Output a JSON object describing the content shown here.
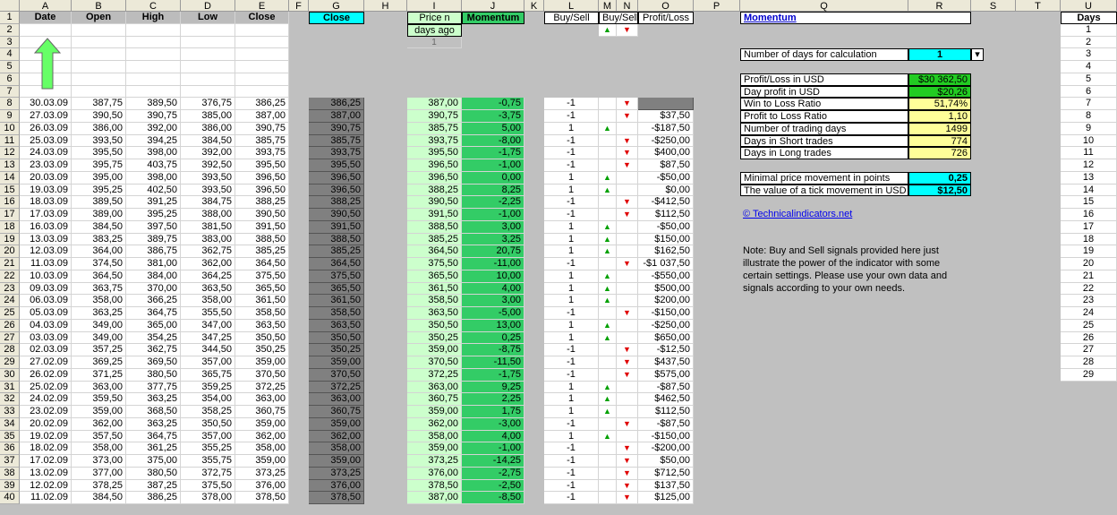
{
  "columns": [
    "A",
    "B",
    "C",
    "D",
    "E",
    "F",
    "G",
    "H",
    "I",
    "J",
    "K",
    "L",
    "M",
    "N",
    "O",
    "P",
    "Q",
    "R",
    "S",
    "T",
    "U"
  ],
  "headers": {
    "date": "Date",
    "open": "Open",
    "high": "High",
    "low": "Low",
    "close": "Close",
    "close_g": "Close",
    "price_n_line1": "Price n",
    "price_n_line2": "days ago",
    "price_n_line3": "1",
    "momentum": "Momentum",
    "buy_sell_l": "Buy/Sell",
    "buy_sell_mn": "Buy/Sell",
    "profit_loss": "Profit/Loss",
    "days": "Days"
  },
  "arrows": {
    "up": "▲",
    "down": "▼"
  },
  "rows": [
    [
      "30.03.09",
      "387,75",
      "389,50",
      "376,75",
      "386,25",
      "386,25",
      "387,00",
      "-0,75",
      "-1",
      "dn",
      ""
    ],
    [
      "27.03.09",
      "390,50",
      "390,75",
      "385,00",
      "387,00",
      "387,00",
      "390,75",
      "-3,75",
      "-1",
      "dn",
      "$37,50"
    ],
    [
      "26.03.09",
      "386,00",
      "392,00",
      "386,00",
      "390,75",
      "390,75",
      "385,75",
      "5,00",
      "1",
      "up",
      "-$187,50"
    ],
    [
      "25.03.09",
      "393,50",
      "394,25",
      "384,50",
      "385,75",
      "385,75",
      "393,75",
      "-8,00",
      "-1",
      "dn",
      "-$250,00"
    ],
    [
      "24.03.09",
      "395,50",
      "398,00",
      "392,00",
      "393,75",
      "393,75",
      "395,50",
      "-1,75",
      "-1",
      "dn",
      "$400,00"
    ],
    [
      "23.03.09",
      "395,75",
      "403,75",
      "392,50",
      "395,50",
      "395,50",
      "396,50",
      "-1,00",
      "-1",
      "dn",
      "$87,50"
    ],
    [
      "20.03.09",
      "395,00",
      "398,00",
      "393,50",
      "396,50",
      "396,50",
      "396,50",
      "0,00",
      "1",
      "up",
      "-$50,00"
    ],
    [
      "19.03.09",
      "395,25",
      "402,50",
      "393,50",
      "396,50",
      "396,50",
      "388,25",
      "8,25",
      "1",
      "up",
      "$0,00"
    ],
    [
      "18.03.09",
      "389,50",
      "391,25",
      "384,75",
      "388,25",
      "388,25",
      "390,50",
      "-2,25",
      "-1",
      "dn",
      "-$412,50"
    ],
    [
      "17.03.09",
      "389,00",
      "395,25",
      "388,00",
      "390,50",
      "390,50",
      "391,50",
      "-1,00",
      "-1",
      "dn",
      "$112,50"
    ],
    [
      "16.03.09",
      "384,50",
      "397,50",
      "381,50",
      "391,50",
      "391,50",
      "388,50",
      "3,00",
      "1",
      "up",
      "-$50,00"
    ],
    [
      "13.03.09",
      "383,25",
      "389,75",
      "383,00",
      "388,50",
      "388,50",
      "385,25",
      "3,25",
      "1",
      "up",
      "$150,00"
    ],
    [
      "12.03.09",
      "364,00",
      "386,75",
      "362,75",
      "385,25",
      "385,25",
      "364,50",
      "20,75",
      "1",
      "up",
      "$162,50"
    ],
    [
      "11.03.09",
      "374,50",
      "381,00",
      "362,00",
      "364,50",
      "364,50",
      "375,50",
      "-11,00",
      "-1",
      "dn",
      "-$1 037,50"
    ],
    [
      "10.03.09",
      "364,50",
      "384,00",
      "364,25",
      "375,50",
      "375,50",
      "365,50",
      "10,00",
      "1",
      "up",
      "-$550,00"
    ],
    [
      "09.03.09",
      "363,75",
      "370,00",
      "363,50",
      "365,50",
      "365,50",
      "361,50",
      "4,00",
      "1",
      "up",
      "$500,00"
    ],
    [
      "06.03.09",
      "358,00",
      "366,25",
      "358,00",
      "361,50",
      "361,50",
      "358,50",
      "3,00",
      "1",
      "up",
      "$200,00"
    ],
    [
      "05.03.09",
      "363,25",
      "364,75",
      "355,50",
      "358,50",
      "358,50",
      "363,50",
      "-5,00",
      "-1",
      "dn",
      "-$150,00"
    ],
    [
      "04.03.09",
      "349,00",
      "365,00",
      "347,00",
      "363,50",
      "363,50",
      "350,50",
      "13,00",
      "1",
      "up",
      "-$250,00"
    ],
    [
      "03.03.09",
      "349,00",
      "354,25",
      "347,25",
      "350,50",
      "350,50",
      "350,25",
      "0,25",
      "1",
      "up",
      "$650,00"
    ],
    [
      "02.03.09",
      "357,25",
      "362,75",
      "344,50",
      "350,25",
      "350,25",
      "359,00",
      "-8,75",
      "-1",
      "dn",
      "-$12,50"
    ],
    [
      "27.02.09",
      "369,25",
      "369,50",
      "357,00",
      "359,00",
      "359,00",
      "370,50",
      "-11,50",
      "-1",
      "dn",
      "$437,50"
    ],
    [
      "26.02.09",
      "371,25",
      "380,50",
      "365,75",
      "370,50",
      "370,50",
      "372,25",
      "-1,75",
      "-1",
      "dn",
      "$575,00"
    ],
    [
      "25.02.09",
      "363,00",
      "377,75",
      "359,25",
      "372,25",
      "372,25",
      "363,00",
      "9,25",
      "1",
      "up",
      "-$87,50"
    ],
    [
      "24.02.09",
      "359,50",
      "363,25",
      "354,00",
      "363,00",
      "363,00",
      "360,75",
      "2,25",
      "1",
      "up",
      "$462,50"
    ],
    [
      "23.02.09",
      "359,00",
      "368,50",
      "358,25",
      "360,75",
      "360,75",
      "359,00",
      "1,75",
      "1",
      "up",
      "$112,50"
    ],
    [
      "20.02.09",
      "362,00",
      "363,25",
      "350,50",
      "359,00",
      "359,00",
      "362,00",
      "-3,00",
      "-1",
      "dn",
      "-$87,50"
    ],
    [
      "19.02.09",
      "357,50",
      "364,75",
      "357,00",
      "362,00",
      "362,00",
      "358,00",
      "4,00",
      "1",
      "up",
      "-$150,00"
    ],
    [
      "18.02.09",
      "358,00",
      "361,25",
      "355,25",
      "358,00",
      "358,00",
      "359,00",
      "-1,00",
      "-1",
      "dn",
      "-$200,00"
    ],
    [
      "17.02.09",
      "373,00",
      "375,00",
      "355,75",
      "359,00",
      "359,00",
      "373,25",
      "-14,25",
      "-1",
      "dn",
      "$50,00"
    ],
    [
      "13.02.09",
      "377,00",
      "380,50",
      "372,75",
      "373,25",
      "373,25",
      "376,00",
      "-2,75",
      "-1",
      "dn",
      "$712,50"
    ],
    [
      "12.02.09",
      "378,25",
      "387,25",
      "375,50",
      "376,00",
      "376,00",
      "378,50",
      "-2,50",
      "-1",
      "dn",
      "$137,50"
    ],
    [
      "11.02.09",
      "384,50",
      "386,25",
      "378,00",
      "378,50",
      "378,50",
      "387,00",
      "-8,50",
      "-1",
      "dn",
      "$125,00"
    ]
  ],
  "panel": {
    "title": "Momentum",
    "days_label": "Number of days for calculation",
    "days_value": "1",
    "stats": [
      {
        "label": "Profit/Loss in USD",
        "value": "$30 362,50"
      },
      {
        "label": "Day profit in USD",
        "value": "$20,26"
      },
      {
        "label": "Win to Loss Ratio",
        "value": "51,74%"
      },
      {
        "label": "Profit to Loss Ratio",
        "value": "1,10"
      },
      {
        "label": "Number of trading days",
        "value": "1499"
      },
      {
        "label": "Days in Short trades",
        "value": "774"
      },
      {
        "label": "Days in Long trades",
        "value": "726"
      }
    ],
    "tick": [
      {
        "label": "Minimal price movement in points",
        "value": "0,25"
      },
      {
        "label": "The value of a tick movement in USD",
        "value": "$12,50"
      }
    ],
    "link": "© Technicalindicators.net",
    "note": [
      "Note: Buy and Sell signals provided here just",
      "illustrate the power of the indicator with some",
      "certain settings. Please use your own data and",
      "signals according to your own needs."
    ]
  },
  "days_list": [
    "1",
    "2",
    "3",
    "4",
    "5",
    "6",
    "7",
    "8",
    "9",
    "10",
    "11",
    "12",
    "13",
    "14",
    "15",
    "16",
    "17",
    "18",
    "19",
    "20",
    "21",
    "22",
    "23",
    "24",
    "25",
    "26",
    "27",
    "28",
    "29"
  ]
}
